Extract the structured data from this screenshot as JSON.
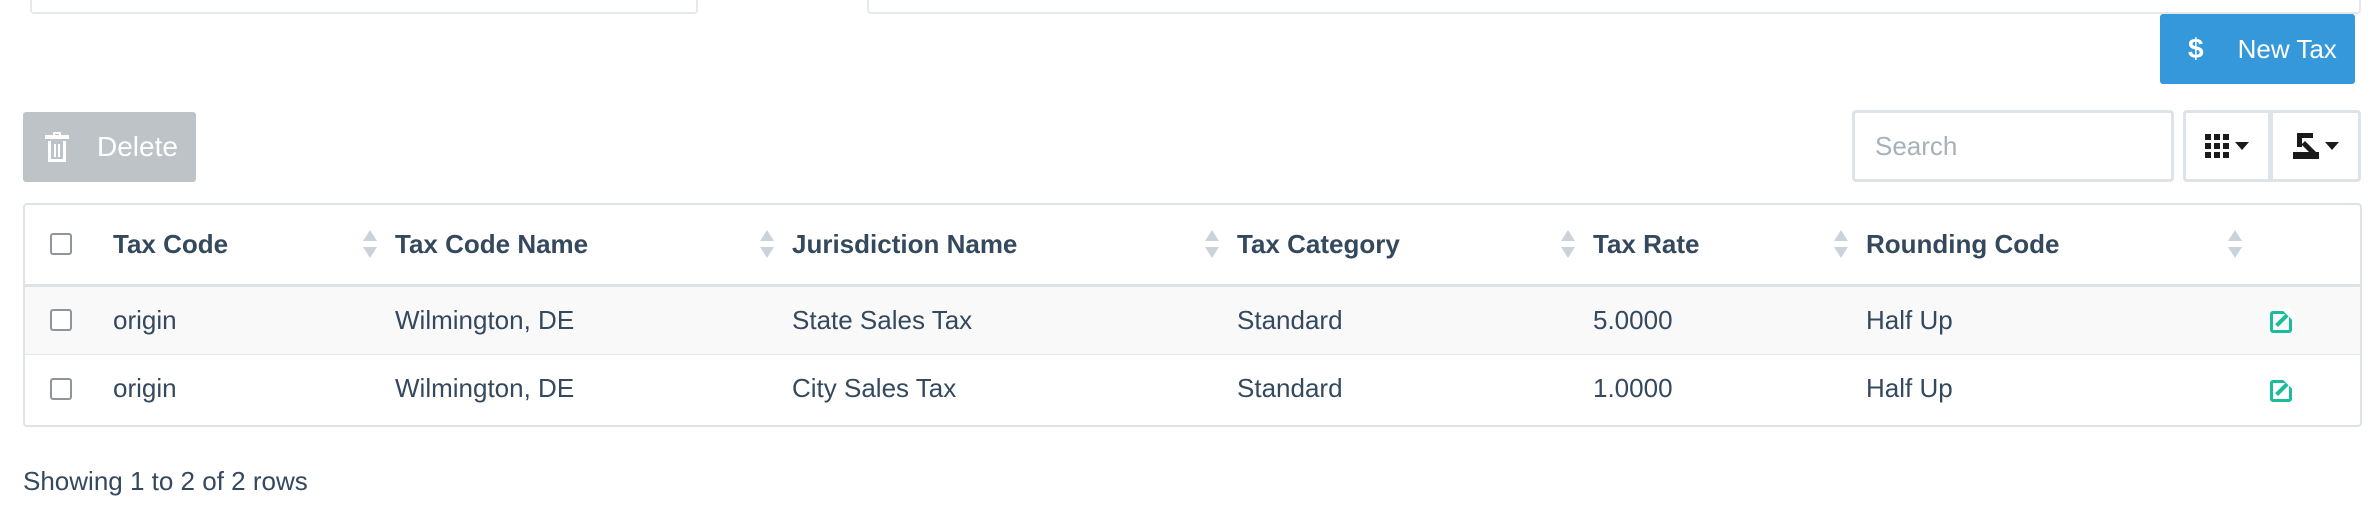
{
  "toolbar": {
    "new_tax_label": "New Tax",
    "new_tax_icon": "$",
    "delete_label": "Delete",
    "search_placeholder": "Search"
  },
  "table": {
    "columns": [
      "Tax Code",
      "Tax Code Name",
      "Jurisdiction Name",
      "Tax Category",
      "Tax Rate",
      "Rounding Code"
    ],
    "rows": [
      {
        "tax_code": "origin",
        "tax_code_name": "Wilmington, DE",
        "jurisdiction": "State Sales Tax",
        "category": "Standard",
        "rate": "5.0000",
        "rounding": "Half Up"
      },
      {
        "tax_code": "origin",
        "tax_code_name": "Wilmington, DE",
        "jurisdiction": "City Sales Tax",
        "category": "Standard",
        "rate": "1.0000",
        "rounding": "Half Up"
      }
    ]
  },
  "footer": {
    "pagination_text": "Showing 1 to 2 of 2 rows"
  },
  "colors": {
    "primary": "#3498db",
    "disabled": "#bdc3c7",
    "edit": "#1abc9c",
    "text": "#34495e"
  }
}
